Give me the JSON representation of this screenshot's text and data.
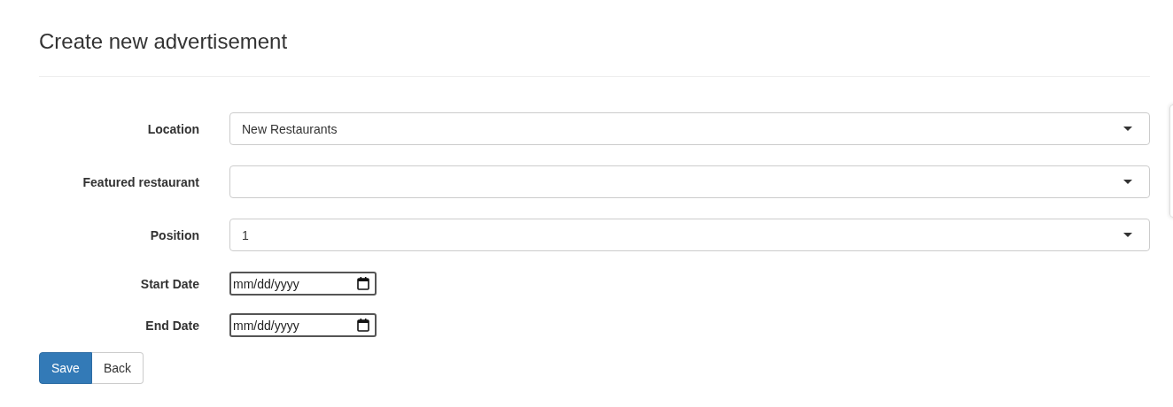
{
  "page": {
    "title": "Create new advertisement"
  },
  "fields": [
    {
      "kind": "select",
      "label": "Location",
      "value": "New Restaurants"
    },
    {
      "kind": "select",
      "label": "Featured restaurant"
    },
    {
      "kind": "select",
      "label": "Position",
      "value": "1"
    },
    {
      "kind": "date",
      "label": "Start Date",
      "placeholder": "mm/dd/yyyy"
    },
    {
      "kind": "date",
      "label": "End Date",
      "placeholder": "mm/dd/yyyy"
    }
  ],
  "buttons": [
    {
      "label": "Save",
      "kind": "primary"
    },
    {
      "label": "Back",
      "kind": "default"
    }
  ]
}
